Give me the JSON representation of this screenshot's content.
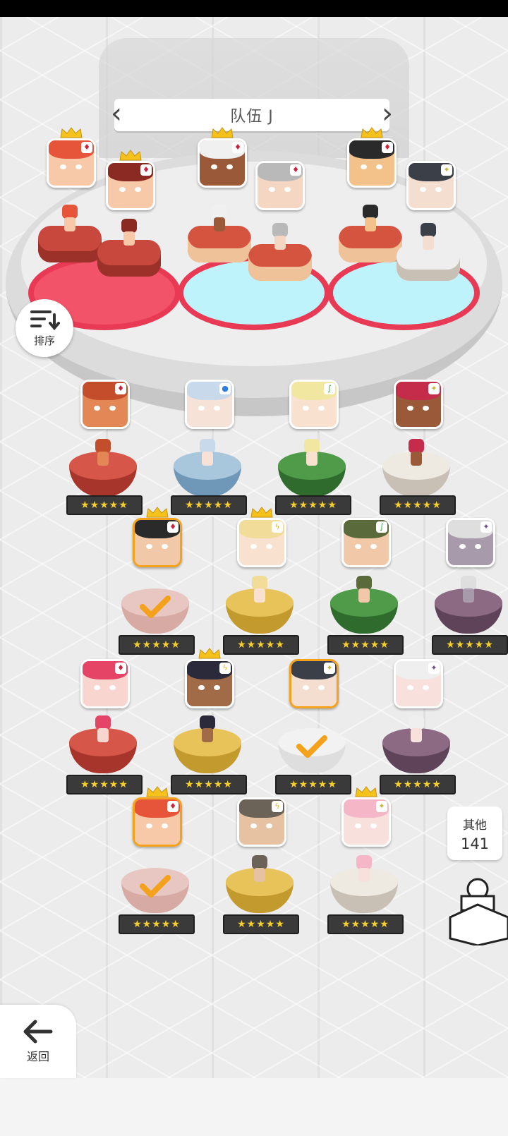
{
  "team": {
    "name": "队伍 J",
    "prev_icon": "chevron-left-icon",
    "next_icon": "chevron-right-icon"
  },
  "sort_button": {
    "label": "排序",
    "icon": "sort-icon"
  },
  "back_button": {
    "label": "返回",
    "icon": "arrow-left-icon"
  },
  "others": {
    "label": "其他",
    "count": "141"
  },
  "colors": {
    "selected_border": "#f4a11c",
    "red_element": "#d21f3c",
    "star": "#f6cf2e"
  },
  "team_members": [
    {
      "name": "member-1",
      "hair": "#e6553a",
      "skin": "#f7c9a8",
      "crown": true,
      "element": "diamond",
      "pedestal": "red"
    },
    {
      "name": "member-2",
      "hair": "#8b2a22",
      "skin": "#f7c9a8",
      "crown": true,
      "element": "diamond",
      "pedestal": "red"
    },
    {
      "name": "member-3",
      "hair": "#f0f0f0",
      "skin": "#9a5a3a",
      "crown": true,
      "element": "diamond",
      "pedestal": "cake"
    },
    {
      "name": "member-4",
      "hair": "#b9b9b9",
      "skin": "#f4d6c2",
      "crown": false,
      "element": "diamond",
      "pedestal": "cake"
    },
    {
      "name": "member-5",
      "hair": "#2a2a2a",
      "skin": "#f2c28a",
      "crown": true,
      "element": "diamond",
      "pedestal": "cake"
    },
    {
      "name": "member-6",
      "hair": "#3b3f48",
      "skin": "#f4ded0",
      "crown": false,
      "element": "light",
      "pedestal": "cream"
    }
  ],
  "roster": [
    {
      "hair": "#c44d2c",
      "skin": "#e28755",
      "element": "diamond",
      "pedestal": "red",
      "stars": "★★★★★",
      "crown": false,
      "selected": false
    },
    {
      "hair": "#c9d9ec",
      "skin": "#f6e2d6",
      "element": "water",
      "pedestal": "blue",
      "stars": "★★★★★",
      "crown": false,
      "selected": false
    },
    {
      "hair": "#f2e7a1",
      "skin": "#f8e1cf",
      "element": "wind",
      "pedestal": "green",
      "stars": "★★★★★",
      "crown": false,
      "selected": false
    },
    {
      "hair": "#c42c4a",
      "skin": "#9a5a3a",
      "element": "light",
      "pedestal": "white",
      "stars": "★★★★★",
      "crown": false,
      "selected": false
    },
    {
      "hair": "#2a2a2a",
      "skin": "#f2c9a8",
      "element": "diamond",
      "pedestal": "red-faded",
      "stars": "★★★★★",
      "crown": true,
      "selected": true
    },
    {
      "hair": "#f1dd99",
      "skin": "#f8e1cf",
      "element": "lightning",
      "pedestal": "gold",
      "stars": "★★★★★",
      "crown": true,
      "selected": false
    },
    {
      "hair": "#5a6a3a",
      "skin": "#f2c9a8",
      "element": "wind",
      "pedestal": "green",
      "stars": "★★★★★",
      "crown": false,
      "selected": false
    },
    {
      "hair": "#dedede",
      "skin": "#a79aaa",
      "element": "dark",
      "pedestal": "purple",
      "stars": "★★★★★",
      "crown": false,
      "selected": false
    },
    {
      "hair": "#e64466",
      "skin": "#f8d6cf",
      "element": "diamond",
      "pedestal": "red",
      "stars": "★★★★★",
      "crown": false,
      "selected": false
    },
    {
      "hair": "#2a2a3a",
      "skin": "#a26b48",
      "element": "lightning",
      "pedestal": "gold",
      "stars": "★★★★★",
      "crown": true,
      "selected": false
    },
    {
      "hair": "#3b3f48",
      "skin": "#f4ded0",
      "element": "light",
      "pedestal": "white-faded",
      "stars": "★★★★★",
      "crown": false,
      "selected": true
    },
    {
      "hair": "#efefef",
      "skin": "#f8e1dc",
      "element": "dark",
      "pedestal": "purple",
      "stars": "★★★★★",
      "crown": false,
      "selected": false
    },
    {
      "hair": "#e6553a",
      "skin": "#f7c9a8",
      "element": "diamond",
      "pedestal": "red-faded",
      "stars": "★★★★★",
      "crown": true,
      "selected": true
    },
    {
      "hair": "#6c6358",
      "skin": "#e6c2a3",
      "element": "lightning",
      "pedestal": "gold",
      "stars": "★★★★★",
      "crown": false,
      "selected": false
    },
    {
      "hair": "#f5b7c8",
      "skin": "#f8e1dc",
      "element": "light",
      "pedestal": "white",
      "stars": "★★★★★",
      "crown": true,
      "selected": false
    }
  ]
}
